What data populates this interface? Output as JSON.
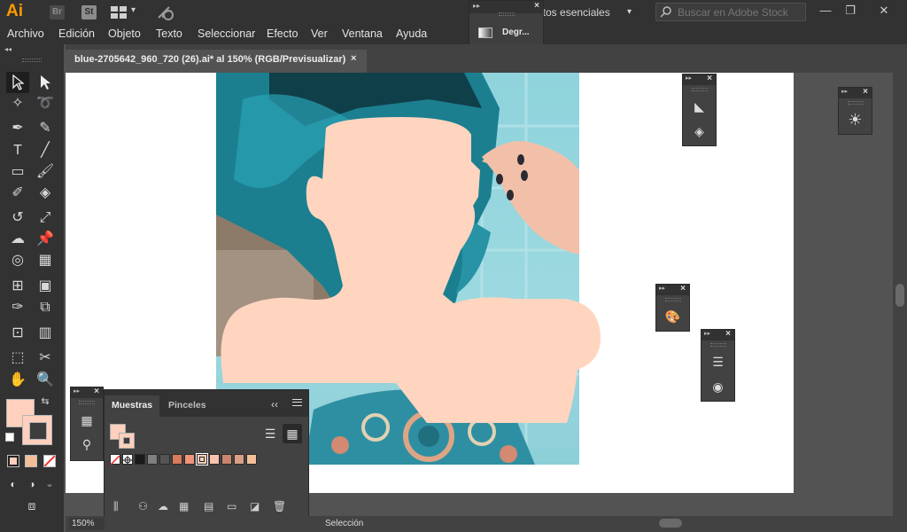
{
  "app": {
    "logo": "Ai",
    "bridge_badge": "Br",
    "stock_badge": "St",
    "workspace_label": "ectos esenciales",
    "search_placeholder": "Buscar en Adobe Stock"
  },
  "menu": [
    "Archivo",
    "Edición",
    "Objeto",
    "Texto",
    "Seleccionar",
    "Efecto",
    "Ver",
    "Ventana",
    "Ayuda"
  ],
  "document_tab": {
    "title": "blue-2705642_960_720 (26).ai* al 150% (RGB/Previsualizar)",
    "close": "×"
  },
  "gradient_panel": {
    "label": "Degr..."
  },
  "swatches_panel": {
    "tabs": [
      "Muestras",
      "Pinceles"
    ],
    "active_tab": "Muestras",
    "swatch_colors": [
      "#ffffff",
      "#ffffff",
      "#1a1a1a",
      "#7f7f7f",
      "#545454",
      "#d97a5f",
      "#f0957a",
      "#ffd0bd",
      "#f7c3ad",
      "#c9856d",
      "#d89e86",
      "#f3bf98"
    ]
  },
  "colors": {
    "fill": "#ffd0bd",
    "accent_logo": "#ff9a00",
    "skin_shape": "#ffd5c0"
  },
  "status": {
    "zoom": "150%",
    "tool_label": "Selección"
  }
}
